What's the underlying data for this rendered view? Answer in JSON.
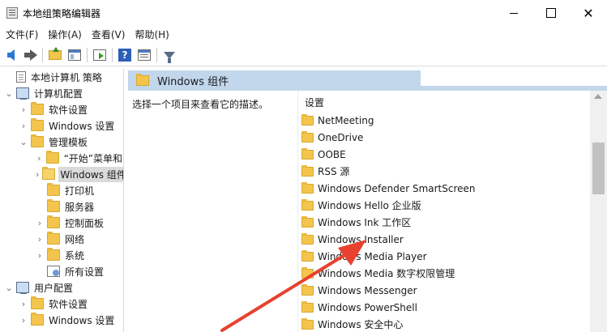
{
  "window": {
    "title": "本地组策略编辑器",
    "close_glyph": "✕"
  },
  "menu": [
    "文件(F)",
    "操作(A)",
    "查看(V)",
    "帮助(H)"
  ],
  "toolbar": {
    "help_glyph": "?"
  },
  "tree": [
    {
      "label": "本地计算机 策略",
      "icon": "doc-icon",
      "depth": 0,
      "chevron": ""
    },
    {
      "label": "计算机配置",
      "icon": "computer-icon",
      "depth": 0,
      "chevron": "⌄"
    },
    {
      "label": "软件设置",
      "icon": "folder-icon",
      "depth": 1,
      "chevron": "›"
    },
    {
      "label": "Windows 设置",
      "icon": "folder-icon",
      "depth": 1,
      "chevron": "›"
    },
    {
      "label": "管理模板",
      "icon": "folder-icon",
      "depth": 1,
      "chevron": "⌄"
    },
    {
      "label": "“开始”菜单和",
      "icon": "folder-icon",
      "depth": 2,
      "chevron": "›"
    },
    {
      "label": "Windows 组件",
      "icon": "folder-open-icon",
      "depth": 2,
      "chevron": "›",
      "selected": true
    },
    {
      "label": "打印机",
      "icon": "folder-icon",
      "depth": 2,
      "chevron": ""
    },
    {
      "label": "服务器",
      "icon": "folder-icon",
      "depth": 2,
      "chevron": ""
    },
    {
      "label": "控制面板",
      "icon": "folder-icon",
      "depth": 2,
      "chevron": "›"
    },
    {
      "label": "网络",
      "icon": "folder-icon",
      "depth": 2,
      "chevron": "›"
    },
    {
      "label": "系统",
      "icon": "folder-icon",
      "depth": 2,
      "chevron": "›"
    },
    {
      "label": "所有设置",
      "icon": "all-settings-icon",
      "depth": 2,
      "chevron": ""
    },
    {
      "label": "用户配置",
      "icon": "computer-icon",
      "depth": 0,
      "chevron": "⌄"
    },
    {
      "label": "软件设置",
      "icon": "folder-icon",
      "depth": 1,
      "chevron": "›"
    },
    {
      "label": "Windows 设置",
      "icon": "folder-icon",
      "depth": 1,
      "chevron": "›"
    }
  ],
  "right": {
    "header": "Windows 组件",
    "description": "选择一个项目来查看它的描述。",
    "column_header": "设置",
    "items": [
      "NetMeeting",
      "OneDrive",
      "OOBE",
      "RSS 源",
      "Windows Defender SmartScreen",
      "Windows Hello 企业版",
      "Windows Ink 工作区",
      "Windows Installer",
      "Windows Media Player",
      "Windows Media 数字权限管理",
      "Windows Messenger",
      "Windows PowerShell",
      "Windows 安全中心"
    ]
  },
  "colors": {
    "header_bg": "#c2d6ec",
    "selected_bg": "#dadada",
    "annotation": "#e8412f",
    "folder": "#f3c54d"
  }
}
